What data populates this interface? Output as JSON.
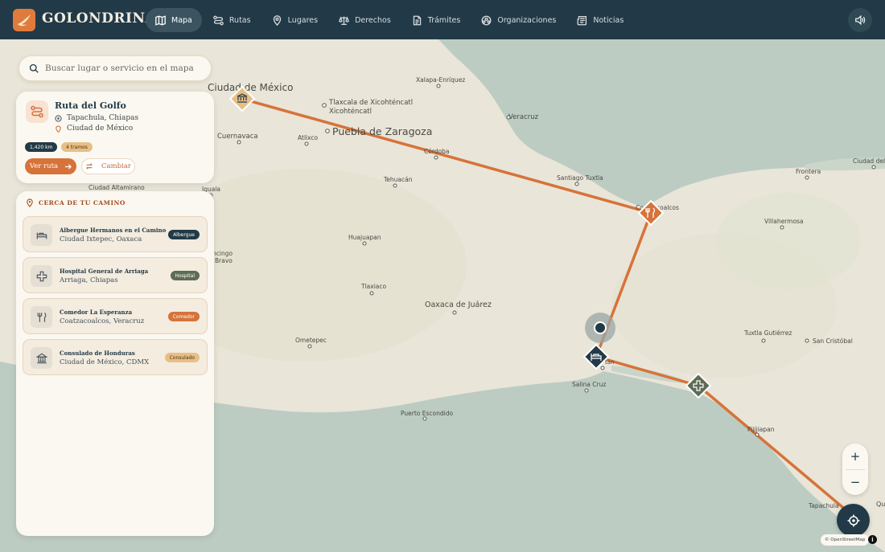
{
  "brand": {
    "name": "GOLONDRINAS"
  },
  "nav": [
    {
      "label": "Mapa",
      "icon": "map-icon",
      "active": true
    },
    {
      "label": "Rutas",
      "icon": "route-icon"
    },
    {
      "label": "Lugares",
      "icon": "pin-icon"
    },
    {
      "label": "Derechos",
      "icon": "scale-icon"
    },
    {
      "label": "Trámites",
      "icon": "document-icon"
    },
    {
      "label": "Organizaciones",
      "icon": "organizations-icon"
    },
    {
      "label": "Noticias",
      "icon": "news-icon"
    }
  ],
  "search": {
    "placeholder": "Buscar lugar o servicio en el mapa"
  },
  "route": {
    "title": "Ruta del Golfo",
    "origin": "Tapachula, Chiapas",
    "destination": "Ciudad de México",
    "distance": "1,420 km",
    "segments": "4 tramos",
    "primary_button": "Ver ruta",
    "secondary_button": "Cambiar"
  },
  "nearby": {
    "heading": "CERCA DE TU CAMINO",
    "items": [
      {
        "name": "Albergue Hermanos en el Camino",
        "location": "Ciudad Ixtepec, Oaxaca",
        "tag": "Albergue",
        "icon": "bed-icon"
      },
      {
        "name": "Hospital General de Arriaga",
        "location": "Arriaga, Chiapas",
        "tag": "Hospital",
        "icon": "cross-icon"
      },
      {
        "name": "Comedor La Esperanza",
        "location": "Coatzacoalcos, Veracruz",
        "tag": "Comedor",
        "icon": "fork-knife-icon"
      },
      {
        "name": "Consulado de Honduras",
        "location": "Ciudad de México, CDMX",
        "tag": "Consulado",
        "icon": "bank-icon"
      }
    ]
  },
  "map": {
    "cities": [
      "Ciudad de México",
      "Puebla de Zaragoza",
      "Tlaxcala de Xicohténcatl",
      "Xalapa-Enríquez",
      "Veracruz",
      "Cuernavaca",
      "Atlixco",
      "Córdoba",
      "Tehuacán",
      "Santiago Tuxtla",
      "Coatzacoalcos",
      "Villahermosa",
      "Frontera",
      "Ciudad del C",
      "Ciudad Altamirano",
      "Iguala",
      "Huajuapan",
      "Chilpancingo de los Bravo",
      "Tlaxiaco",
      "Oaxaca de Juárez",
      "Ometepec",
      "Juchitán",
      "Salina Cruz",
      "Puerto Escondido",
      "Tuxtla Gutiérrez",
      "San Cristóbal",
      "Pijijiapan",
      "Tapachula",
      "Qu"
    ],
    "attribution": "© OpenStreetMap",
    "zoom_in": "+",
    "zoom_out": "−",
    "info": "i"
  },
  "colors": {
    "navy": "#223a47",
    "orange": "#d6733a",
    "sand": "#e7bf86",
    "cream": "#fbf8f1",
    "sea": "#bcccc2",
    "land": "#e9e5d8"
  }
}
